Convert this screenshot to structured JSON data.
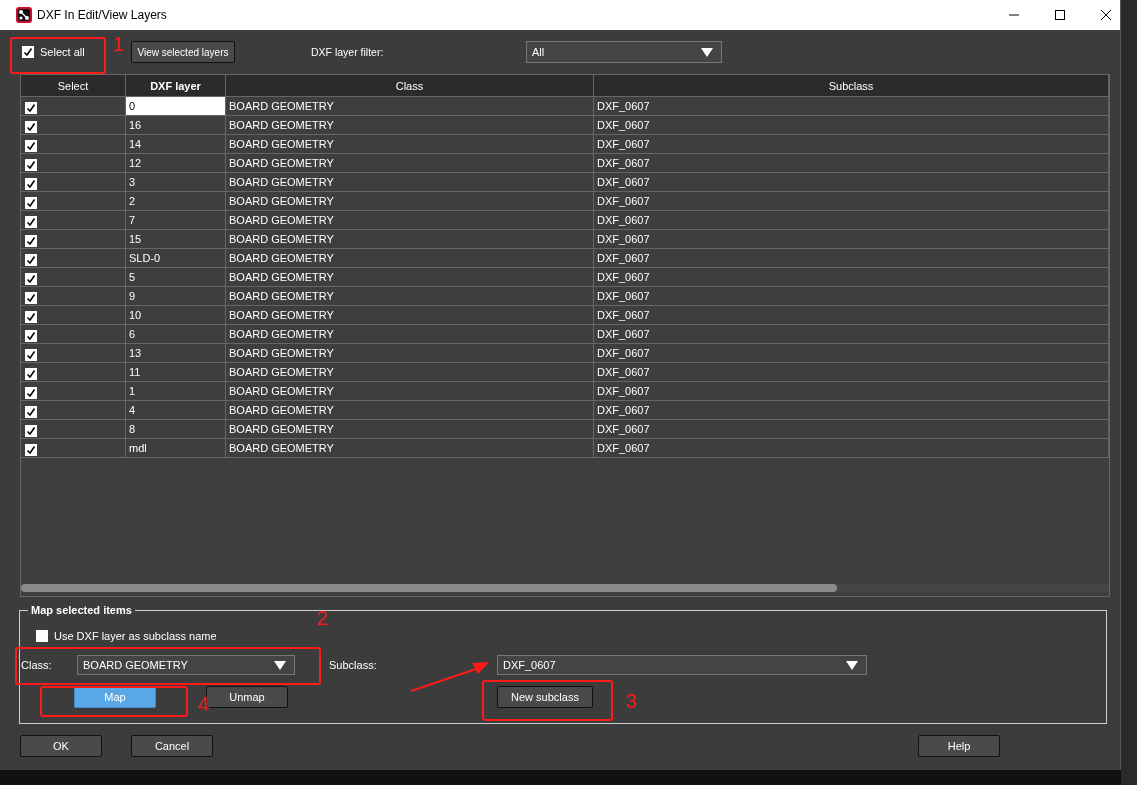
{
  "window": {
    "title": "DXF In Edit/View Layers"
  },
  "toolbar": {
    "select_all": {
      "label": "Select all",
      "checked": true
    },
    "view_button": "View selected layers",
    "filter_label": "DXF layer filter:",
    "filter_value": "All"
  },
  "table": {
    "columns": [
      "Select",
      "DXF layer",
      "Class",
      "Subclass"
    ],
    "rows": [
      {
        "checked": true,
        "selected": true,
        "layer": "0",
        "class": "BOARD GEOMETRY",
        "subclass": "DXF_0607"
      },
      {
        "checked": true,
        "selected": false,
        "layer": "16",
        "class": "BOARD GEOMETRY",
        "subclass": "DXF_0607"
      },
      {
        "checked": true,
        "selected": false,
        "layer": "14",
        "class": "BOARD GEOMETRY",
        "subclass": "DXF_0607"
      },
      {
        "checked": true,
        "selected": false,
        "layer": "12",
        "class": "BOARD GEOMETRY",
        "subclass": "DXF_0607"
      },
      {
        "checked": true,
        "selected": false,
        "layer": "3",
        "class": "BOARD GEOMETRY",
        "subclass": "DXF_0607"
      },
      {
        "checked": true,
        "selected": false,
        "layer": "2",
        "class": "BOARD GEOMETRY",
        "subclass": "DXF_0607"
      },
      {
        "checked": true,
        "selected": false,
        "layer": "7",
        "class": "BOARD GEOMETRY",
        "subclass": "DXF_0607"
      },
      {
        "checked": true,
        "selected": false,
        "layer": "15",
        "class": "BOARD GEOMETRY",
        "subclass": "DXF_0607"
      },
      {
        "checked": true,
        "selected": false,
        "layer": "SLD-0",
        "class": "BOARD GEOMETRY",
        "subclass": "DXF_0607"
      },
      {
        "checked": true,
        "selected": false,
        "layer": "5",
        "class": "BOARD GEOMETRY",
        "subclass": "DXF_0607"
      },
      {
        "checked": true,
        "selected": false,
        "layer": "9",
        "class": "BOARD GEOMETRY",
        "subclass": "DXF_0607"
      },
      {
        "checked": true,
        "selected": false,
        "layer": "10",
        "class": "BOARD GEOMETRY",
        "subclass": "DXF_0607"
      },
      {
        "checked": true,
        "selected": false,
        "layer": "6",
        "class": "BOARD GEOMETRY",
        "subclass": "DXF_0607"
      },
      {
        "checked": true,
        "selected": false,
        "layer": "13",
        "class": "BOARD GEOMETRY",
        "subclass": "DXF_0607"
      },
      {
        "checked": true,
        "selected": false,
        "layer": "11",
        "class": "BOARD GEOMETRY",
        "subclass": "DXF_0607"
      },
      {
        "checked": true,
        "selected": false,
        "layer": "1",
        "class": "BOARD GEOMETRY",
        "subclass": "DXF_0607"
      },
      {
        "checked": true,
        "selected": false,
        "layer": "4",
        "class": "BOARD GEOMETRY",
        "subclass": "DXF_0607"
      },
      {
        "checked": true,
        "selected": false,
        "layer": "8",
        "class": "BOARD GEOMETRY",
        "subclass": "DXF_0607"
      },
      {
        "checked": true,
        "selected": false,
        "layer": "mdl",
        "class": "BOARD GEOMETRY",
        "subclass": "DXF_0607"
      }
    ]
  },
  "map_group": {
    "title": "Map selected items",
    "use_layer_name": {
      "label": "Use DXF layer as subclass name",
      "checked": false
    },
    "class_label": "Class:",
    "class_value": "BOARD GEOMETRY",
    "subclass_label": "Subclass:",
    "subclass_value": "DXF_0607",
    "buttons": [
      {
        "label": "Map",
        "primary": true
      },
      {
        "label": "Unmap",
        "primary": false
      }
    ],
    "new_subclass": "New subclass"
  },
  "footer_buttons": [
    {
      "label": "OK"
    },
    {
      "label": "Cancel"
    },
    {
      "label": "Help"
    }
  ],
  "annotations": [
    {
      "kind": "box",
      "number": "1"
    },
    {
      "kind": "box",
      "number": "2"
    },
    {
      "kind": "box",
      "number": "4"
    },
    {
      "kind": "box",
      "number": "3"
    },
    {
      "kind": "arrow"
    }
  ]
}
